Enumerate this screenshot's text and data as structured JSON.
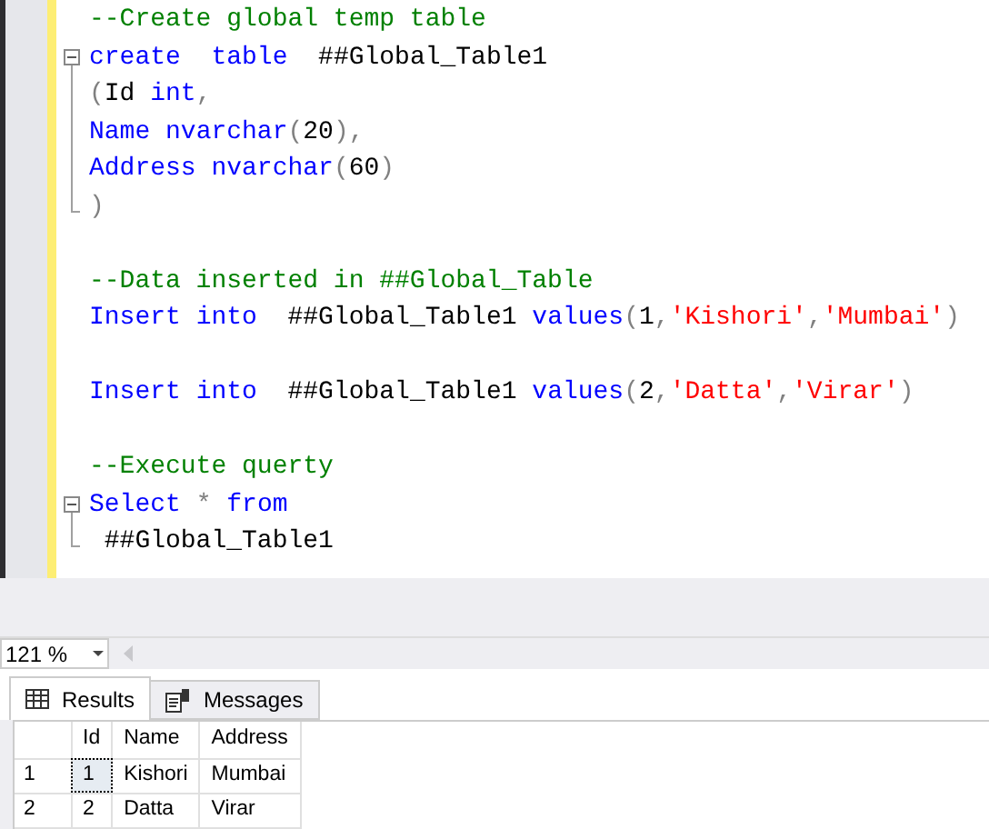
{
  "editor": {
    "blocks": [
      {
        "statements": [
          {
            "lines": [
              [
                {
                  "kind": "comment",
                  "text": "--Create global temp table"
                }
              ]
            ]
          },
          {
            "expanded": true,
            "lines": [
              [
                {
                  "kind": "keyword",
                  "text": "create"
                },
                {
                  "kind": "keyword",
                  "text": "  table"
                },
                {
                  "kind": "plain",
                  "text": "  ##Global_Table1"
                }
              ],
              [
                {
                  "kind": "punct",
                  "text": "("
                },
                {
                  "kind": "plain",
                  "text": "Id "
                },
                {
                  "kind": "keyword",
                  "text": "int"
                },
                {
                  "kind": "punct",
                  "text": ","
                }
              ],
              [
                {
                  "kind": "keyword",
                  "text": "Name"
                },
                {
                  "kind": "keyword",
                  "text": " nvarchar"
                },
                {
                  "kind": "punct",
                  "text": "("
                },
                {
                  "kind": "plain",
                  "text": "20"
                },
                {
                  "kind": "punct",
                  "text": "),"
                }
              ],
              [
                {
                  "kind": "keyword",
                  "text": "Address"
                },
                {
                  "kind": "keyword",
                  "text": " nvarchar"
                },
                {
                  "kind": "punct",
                  "text": "("
                },
                {
                  "kind": "plain",
                  "text": "60"
                },
                {
                  "kind": "punct",
                  "text": ")"
                }
              ],
              [
                {
                  "kind": "punct",
                  "text": ")"
                }
              ]
            ]
          }
        ]
      },
      {
        "statements": [
          {
            "lines": [
              [
                {
                  "kind": "comment",
                  "text": "--Data inserted in ##Global_Table"
                }
              ]
            ]
          },
          {
            "lines": [
              [
                {
                  "kind": "keyword",
                  "text": "Insert"
                },
                {
                  "kind": "keyword",
                  "text": " into"
                },
                {
                  "kind": "plain",
                  "text": "  ##Global_Table1 "
                },
                {
                  "kind": "keyword",
                  "text": "values"
                },
                {
                  "kind": "punct",
                  "text": "("
                },
                {
                  "kind": "plain",
                  "text": "1"
                },
                {
                  "kind": "punct",
                  "text": ","
                },
                {
                  "kind": "string",
                  "text": "'Kishori'"
                },
                {
                  "kind": "punct",
                  "text": ","
                },
                {
                  "kind": "string",
                  "text": "'Mumbai'"
                },
                {
                  "kind": "punct",
                  "text": ")"
                }
              ]
            ]
          }
        ]
      },
      {
        "statements": [
          {
            "lines": [
              [
                {
                  "kind": "keyword",
                  "text": "Insert"
                },
                {
                  "kind": "keyword",
                  "text": " into"
                },
                {
                  "kind": "plain",
                  "text": "  ##Global_Table1 "
                },
                {
                  "kind": "keyword",
                  "text": "values"
                },
                {
                  "kind": "punct",
                  "text": "("
                },
                {
                  "kind": "plain",
                  "text": "2"
                },
                {
                  "kind": "punct",
                  "text": ","
                },
                {
                  "kind": "string",
                  "text": "'Datta'"
                },
                {
                  "kind": "punct",
                  "text": ","
                },
                {
                  "kind": "string",
                  "text": "'Virar'"
                },
                {
                  "kind": "punct",
                  "text": ")"
                }
              ]
            ]
          }
        ]
      },
      {
        "statements": [
          {
            "lines": [
              [
                {
                  "kind": "comment",
                  "text": "--Execute querty"
                }
              ]
            ]
          },
          {
            "expanded": true,
            "lines": [
              [
                {
                  "kind": "keyword",
                  "text": "Select"
                },
                {
                  "kind": "punct",
                  "text": " *"
                },
                {
                  "kind": "keyword",
                  "text": " from"
                }
              ],
              [
                {
                  "kind": "plain",
                  "text": " ##Global_Table1"
                }
              ]
            ]
          }
        ]
      }
    ]
  },
  "zoom": {
    "value": "121 %"
  },
  "result_tabs": [
    {
      "label": "Results",
      "selected": true
    },
    {
      "label": "Messages",
      "selected": false
    }
  ],
  "grid": {
    "columns": [
      "Id",
      "Name",
      "Address"
    ],
    "rows": [
      {
        "number": "1",
        "cells": [
          {
            "text": "1",
            "focused": true
          },
          {
            "text": "Kishori",
            "focused": false
          },
          {
            "text": "Mumbai",
            "focused": false
          }
        ]
      },
      {
        "number": "2",
        "cells": [
          {
            "text": "2",
            "focused": false
          },
          {
            "text": "Datta",
            "focused": false
          },
          {
            "text": "Virar",
            "focused": false
          }
        ]
      }
    ]
  }
}
